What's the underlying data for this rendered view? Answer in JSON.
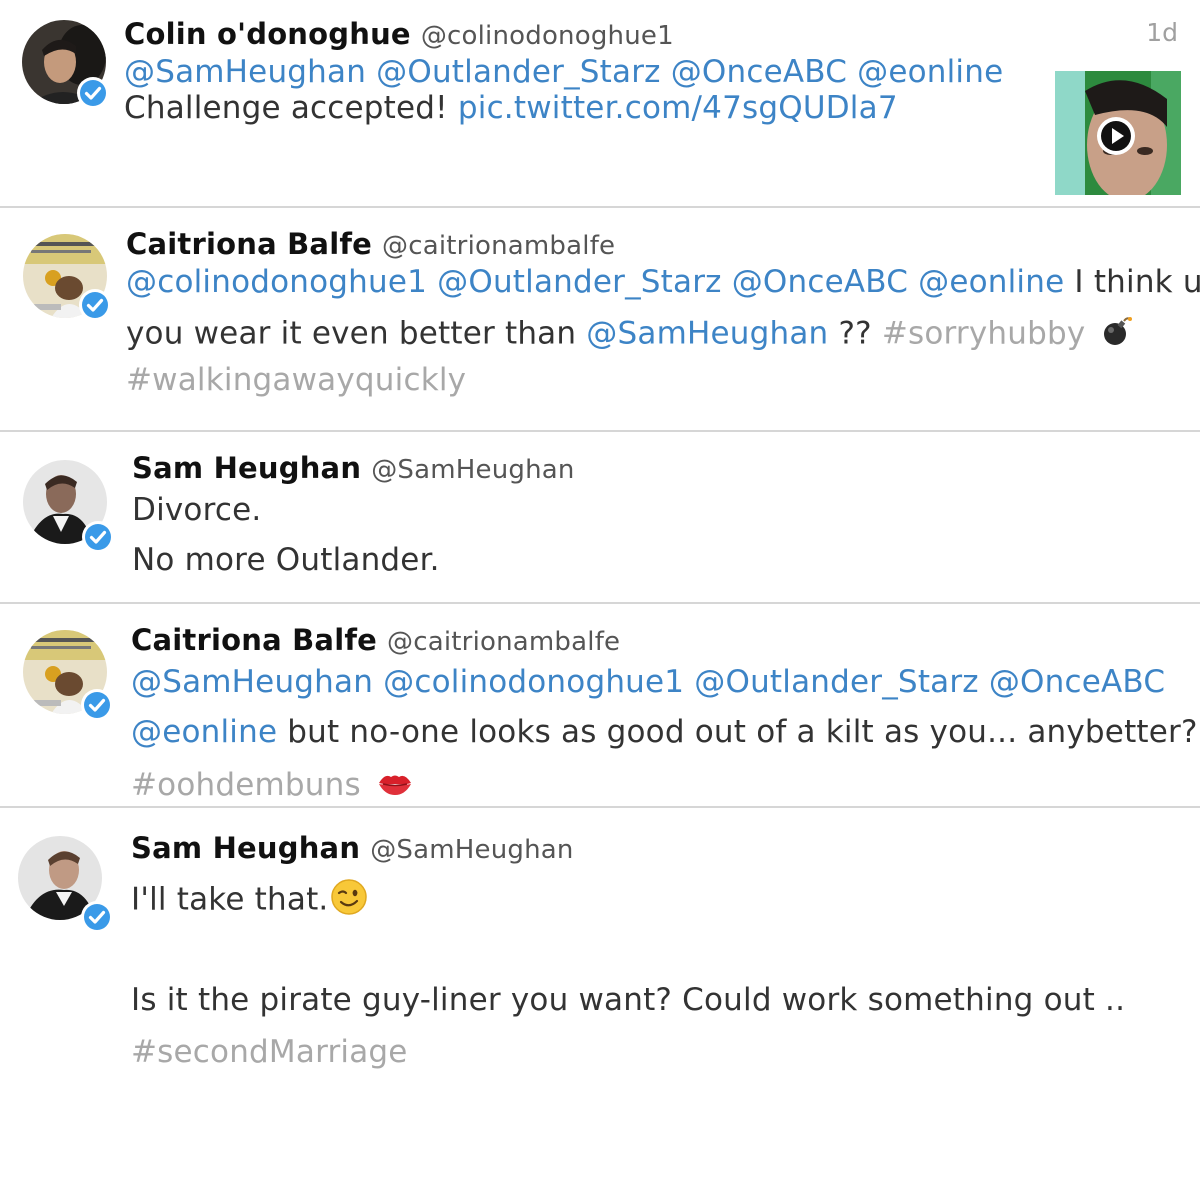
{
  "tweets": [
    {
      "name": "Colin o'donoghue",
      "handle": "@colinodonoghue1",
      "time": "1d",
      "line1": {
        "m1": "@SamHeughan",
        "m2": "@Outlander_Starz",
        "m3": "@OnceABC",
        "m4": "@eonline"
      },
      "line2": {
        "text": "Challenge accepted!",
        "link": "pic.twitter.com/47sgQUDla7"
      },
      "media": "video-thumbnail",
      "play_icon": "play-icon"
    },
    {
      "name": "Caitriona Balfe",
      "handle": "@caitrionambalfe",
      "line1": {
        "m1": "@colinodonoghue1",
        "m2": "@Outlander_Starz",
        "m3": "@OnceABC",
        "m4": "@eonline",
        "text": "I think u"
      },
      "line2": {
        "text1": "you wear it even better than",
        "m1": "@SamHeughan",
        "text2": "??",
        "tag": "#sorryhubby",
        "emoji": "bomb-emoji"
      },
      "line3": {
        "tag": "#walkingawayquickly"
      }
    },
    {
      "name": "Sam Heughan",
      "handle": "@SamHeughan",
      "line1": "Divorce.",
      "line2": "No more Outlander."
    },
    {
      "name": "Caitriona Balfe",
      "handle": "@caitrionambalfe",
      "line1": {
        "m1": "@SamHeughan",
        "m2": "@colinodonoghue1",
        "m3": "@Outlander_Starz",
        "m4": "@OnceABC"
      },
      "line2": {
        "m1": "@eonline",
        "text": "but no-one looks as good out of a kilt as you... anybetter?"
      },
      "line3": {
        "tag": "#oohdembuns",
        "emoji": "lips-emoji"
      }
    },
    {
      "name": "Sam Heughan",
      "handle": "@SamHeughan",
      "line1": {
        "text": "I'll take that.",
        "emoji": "wink-emoji"
      },
      "line2": "Is it the pirate guy-liner you want? Could work something out ..",
      "line3": {
        "tag": "#secondMarriage"
      }
    }
  ],
  "colors": {
    "mention": "#3d84c6",
    "hashtag": "#a8a8a8",
    "verified": "#3a9ae8",
    "divider": "#d6d6d6"
  }
}
